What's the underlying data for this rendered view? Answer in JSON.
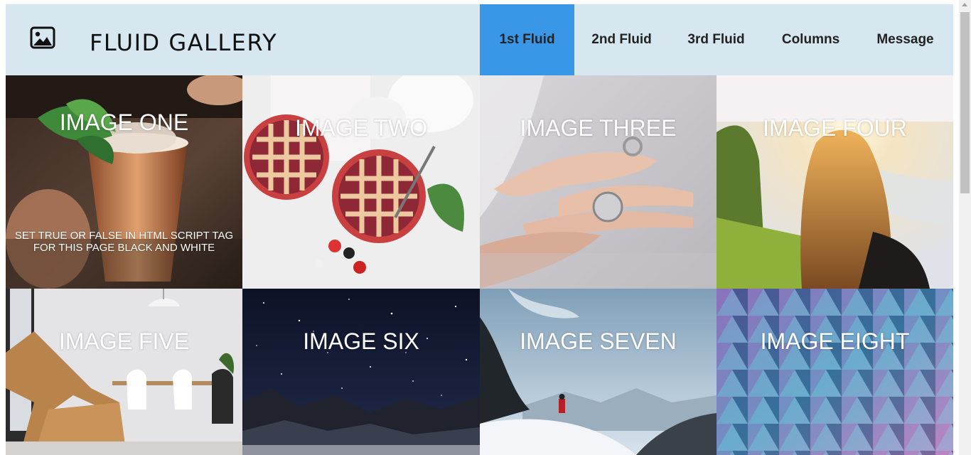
{
  "header": {
    "logo_icon": "image-icon",
    "title": "FLUID GALLERY",
    "background": "#d6e7f0"
  },
  "nav": {
    "items": [
      {
        "label": "1st Fluid",
        "active": true
      },
      {
        "label": "2nd Fluid",
        "active": false
      },
      {
        "label": "3rd Fluid",
        "active": false
      },
      {
        "label": "Columns",
        "active": false
      },
      {
        "label": "Message",
        "active": false
      }
    ],
    "active_color": "#3a96e6"
  },
  "gallery": {
    "tiles": [
      {
        "title": "IMAGE ONE",
        "note": "SET TRUE OR FALSE IN HTML SCRIPT TAG FOR THIS PAGE BLACK AND WHITE"
      },
      {
        "title": "IMAGE TWO"
      },
      {
        "title": "IMAGE THREE"
      },
      {
        "title": "IMAGE FOUR"
      },
      {
        "title": "IMAGE FIVE"
      },
      {
        "title": "IMAGE SIX"
      },
      {
        "title": "IMAGE SEVEN"
      },
      {
        "title": "IMAGE EIGHT"
      }
    ]
  }
}
